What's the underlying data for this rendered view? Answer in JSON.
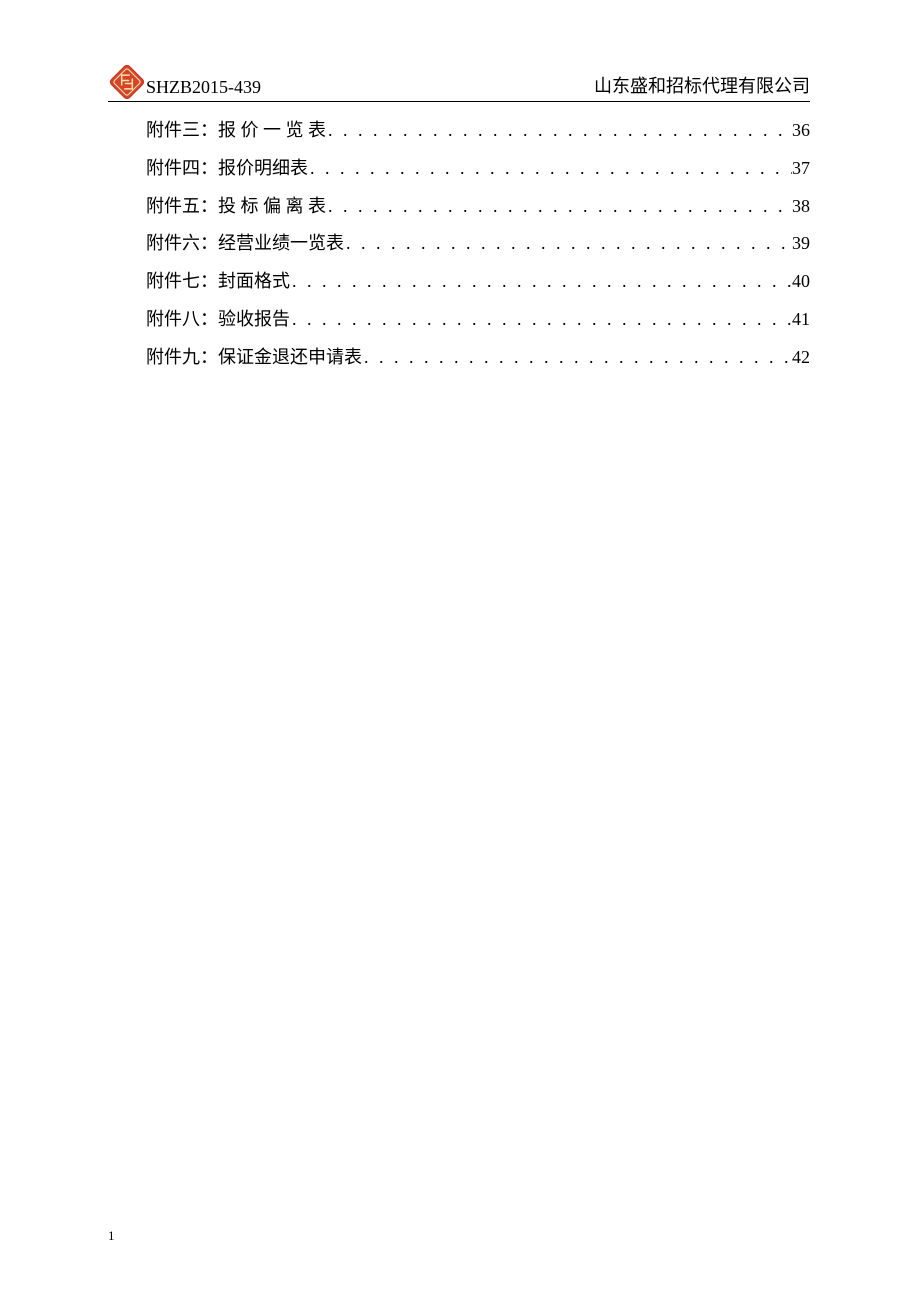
{
  "header": {
    "doc_code": "SHZB2015-439",
    "company": "山东盛和招标代理有限公司"
  },
  "toc_entries": [
    {
      "title": "附件三：报  价 一 览 表",
      "page": "36"
    },
    {
      "title": "附件四：报价明细表",
      "page": "37"
    },
    {
      "title": "附件五：投 标 偏 离 表",
      "page": "38"
    },
    {
      "title": "附件六：经营业绩一览表",
      "page": "39"
    },
    {
      "title": "附件七：封面格式",
      "page": "40"
    },
    {
      "title": "附件八：验收报告",
      "page": "41"
    },
    {
      "title": "附件九：保证金退还申请表",
      "page": "42"
    }
  ],
  "footer": {
    "page_number": "1"
  }
}
